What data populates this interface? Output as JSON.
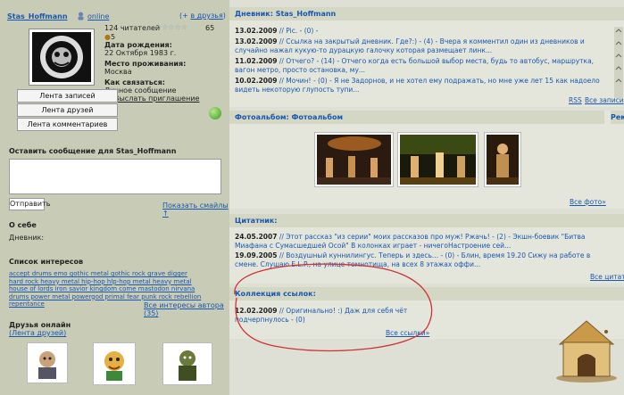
{
  "profile": {
    "username": "Stas_Hoffmann",
    "status": "online",
    "add_friends": "в друзья",
    "readers": "124 читателей",
    "rating_number": "65",
    "count": "5",
    "birthday_label": "Дата рождения:",
    "birthday_value": "22 Октября 1983 г.",
    "location_label": "Место проживания:",
    "location_value": "Москва",
    "contact_label": "Как связаться:",
    "contact_message": "Личное сообщение",
    "contact_invite": "Выслать приглашение"
  },
  "buttons": {
    "records": "Лента записей",
    "friends": "Лента друзей",
    "comments": "Лента комментариев"
  },
  "message": {
    "title": "Оставить сообщение для Stas_Hoffmann",
    "send": "Отправить",
    "smileys": "Показать смайлы ↑"
  },
  "about": {
    "title": "О себе",
    "diary": "Дневник:"
  },
  "interests": {
    "title": "Список интересов",
    "lines": [
      "accept drums emo gothic metal gothic rock grave digger",
      "hard rock heavy metal hip-hop hlp-hop metal heavy metal",
      "house of lords iron savior kingdom come mastodon nirvana",
      "drums power metal powergod primal fear punk rock rebellion repentance"
    ],
    "all": "Все интересы автора (35)"
  },
  "friends_online": {
    "title": "Друзья онлайн",
    "link": "(Лента друзей)"
  },
  "diary": {
    "title": "Дневник: Stas_Hoffmann",
    "entries": [
      {
        "date": "13.02.2009",
        "text": "// Pic. - (0) -"
      },
      {
        "date": "13.02.2009",
        "text": "// Ссылка на закрытый дневник. Где?:) - (4) - Вчера я комментил один из дневников и случайно нажал кукую-то дурацкую галочку которая размещает линк..."
      },
      {
        "date": "11.02.2009",
        "text": "// Отчего? - (14) - Отчего когда есть большой выбор места, будь то автобус, маршрутка, вагон метро, просто остановка, му..."
      },
      {
        "date": "10.02.2009",
        "text": "// Мочин! - (0) - Я не Задорнов, и не хотел ему подражать, но мне уже лет 15 как надоело видеть некоторую глупость тупи..."
      }
    ],
    "rss": "RSS",
    "all": "Все записи"
  },
  "photo": {
    "title": "Фотоальбом: Фотоальбом",
    "side": "Рек",
    "all": "Все фото»"
  },
  "quotes": {
    "title": "Цитатник:",
    "entries": [
      {
        "date": "24.05.2007",
        "text": "// Этот рассказ \"из серии\" моих рассказов про муж! Ржачь! - (2) - Экшн-боевик \"Битва Миафана с Сумасшедшей Осой\" В колонках играет - ничегоНастроение сей..."
      },
      {
        "date": "19.09.2005",
        "text": "// Воздушный куннилингус. Теперь и здесь... - (0) - Блин, время 19.20 Сижу на работе в смене. Слушаю E.L.P., на улице темнотища, на всех 8 этажах оффи..."
      }
    ],
    "all": "Все цитаты"
  },
  "links": {
    "title": "Коллекция ссылок:",
    "entry_date": "12.02.2009",
    "entry_text": "// Оригинально! :) Даж для себя чёт подчерпнулось - (0)",
    "all": "Все ссылки»"
  },
  "colors": {
    "left_bg": "#c8ccb7",
    "right_bg": "#dee0d6",
    "panel_title_bg": "#d4d7c4",
    "link": "#1a57b0",
    "annotation": "#d03030"
  }
}
